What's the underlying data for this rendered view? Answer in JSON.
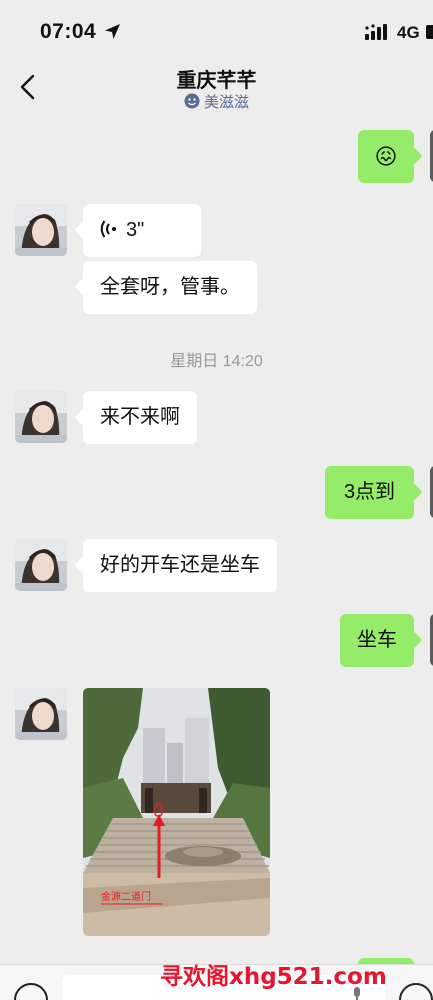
{
  "status_bar": {
    "time": "07:04",
    "network": "4G"
  },
  "header": {
    "title": "重庆芊芊",
    "subtitle": "美滋滋",
    "back_icon": "chevron-left-icon"
  },
  "messages": {
    "m1": {
      "side": "right",
      "text": "😖"
    },
    "m2": {
      "side": "left",
      "type": "voice",
      "text": "3\""
    },
    "m3": {
      "side": "left",
      "text": "全套呀，管事。"
    },
    "divider": "星期日 14:20",
    "m4": {
      "side": "left",
      "text": "来不来啊"
    },
    "m5": {
      "side": "right",
      "text": "3点到"
    },
    "m6": {
      "side": "left",
      "text": "好的开车还是坐车"
    },
    "m7": {
      "side": "right",
      "text": "坐车"
    },
    "m8": {
      "side": "left",
      "type": "image",
      "caption": "金源二道门"
    }
  },
  "input_bar": {
    "voice_icon": "voice-toggle-icon",
    "emoji_icon": "emoji-icon"
  },
  "watermark": "寻欢阁xhg521.com",
  "colors": {
    "background": "#ededed",
    "outgoing_bubble": "#95ec69",
    "incoming_bubble": "#ffffff",
    "subtitle": "#576b95",
    "watermark": "#e8152e"
  }
}
